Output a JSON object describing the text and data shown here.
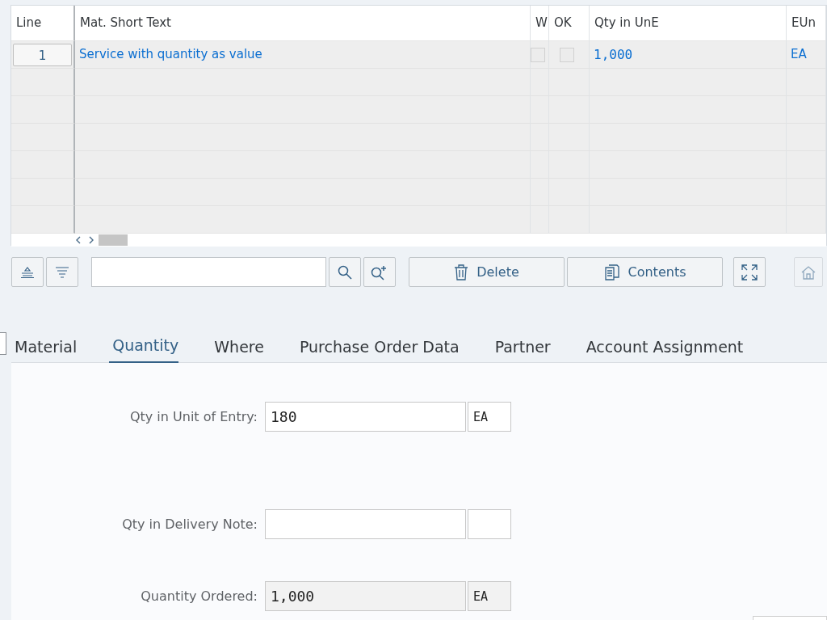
{
  "table": {
    "columns": [
      "Line",
      "Mat. Short Text",
      "W",
      "OK",
      "Qty in UnE",
      "EUn"
    ],
    "rows": [
      {
        "line": "1",
        "short_text": "Service with quantity as value",
        "w_checked": false,
        "ok_checked": false,
        "qty": "1,000",
        "unit": "EA"
      }
    ]
  },
  "toolbar": {
    "buttons": [
      {
        "kind": "sort-up"
      },
      {
        "kind": "sort-down"
      },
      {
        "kind": "search-field"
      },
      {
        "kind": "search"
      },
      {
        "kind": "search-next"
      },
      {
        "kind": "delete",
        "label": "Delete"
      },
      {
        "kind": "contents",
        "label": "Contents"
      },
      {
        "kind": "expand"
      },
      {
        "kind": "home",
        "disabled": true
      }
    ]
  },
  "tabs": [
    {
      "label": "Material",
      "selected": false
    },
    {
      "label": "Quantity",
      "selected": true
    },
    {
      "label": "Where",
      "selected": false
    },
    {
      "label": "Purchase Order Data",
      "selected": false
    },
    {
      "label": "Partner",
      "selected": false
    },
    {
      "label": "Account Assignment",
      "selected": false
    }
  ],
  "fields": [
    {
      "label": "Qty in Unit of Entry:",
      "value": "180",
      "unit": "EA",
      "readonly": false
    },
    {
      "label": "Qty in Delivery Note:",
      "readonly": false
    },
    {
      "label": "Quantity Ordered:",
      "value": "1,000",
      "unit": "EA",
      "readonly": true
    }
  ]
}
